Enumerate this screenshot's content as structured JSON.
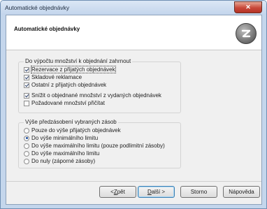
{
  "window": {
    "title": "Automatické objednávky",
    "close_glyph": "✕"
  },
  "header": {
    "title": "Automatické objednávky",
    "logo_icon": "z-logo-icon"
  },
  "group1": {
    "legend": "Do výpočtu množství k objednání zahrnout",
    "options": [
      {
        "label": "Rezervace z přijatých objednávek",
        "checked": true
      },
      {
        "label": "Skladové reklamace",
        "checked": true
      },
      {
        "label": "Ostatní z přijatých objednávek",
        "checked": true
      },
      {
        "label": "Snížit o objednané množství z vydaných objednávek",
        "checked": true
      },
      {
        "label": "Požadované množství přičítat",
        "checked": false
      }
    ]
  },
  "group2": {
    "legend": "Výše předzásobení vybraných zásob",
    "options": [
      {
        "label": "Pouze do výše přijatých objednávek",
        "selected": false
      },
      {
        "label": "Do výše minimálního limitu",
        "selected": true
      },
      {
        "label": "Do výše maximálního limitu (pouze podlimitní zásoby)",
        "selected": false
      },
      {
        "label": "Do výše maximálního limitu",
        "selected": false
      },
      {
        "label": "Do nuly (záporné zásoby)",
        "selected": false
      }
    ]
  },
  "buttons": {
    "back_prefix": "< ",
    "back_key": "Z",
    "back_rest": "pět",
    "next_key": "D",
    "next_rest": "alší >",
    "cancel": "Storno",
    "help": "Nápověda"
  }
}
